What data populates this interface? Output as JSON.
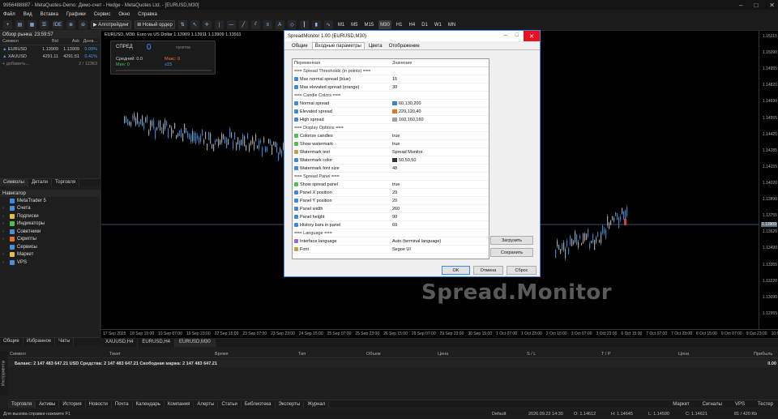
{
  "window": {
    "title": "9956488887 - MetaQuotes-Demo: Демо-счет - Hedge - MetaQuotes Ltd. - [EURUSD,M30]"
  },
  "menu": [
    "Файл",
    "Вид",
    "Вставка",
    "Графики",
    "Сервис",
    "Окно",
    "Справка"
  ],
  "toolbar": {
    "algotrading": "Алготрейдинг",
    "new_order": "Новый ордер",
    "ide": "IDE",
    "timeframes": [
      "M1",
      "M5",
      "M15",
      "M30",
      "H1",
      "H4",
      "D1",
      "W1",
      "MN"
    ],
    "active_timeframe": "M30"
  },
  "market_watch": {
    "title": "Обзор рынка: 23:59:57",
    "columns": [
      "Символ",
      "Bid",
      "Ask",
      "Днев..."
    ],
    "rows": [
      {
        "symbol": "EURUSD",
        "bid": "1.13909",
        "ask": "1.13909",
        "change": "0.09%"
      },
      {
        "symbol": "XAUUSD",
        "bid": "4291.11",
        "ask": "4291.51",
        "change": "0.41%"
      }
    ],
    "add_label": "+ добавить...",
    "count": "2 / 12363"
  },
  "mw_tabs": [
    "Символы",
    "Детали",
    "Торговля"
  ],
  "navigator": {
    "title": "Навигатор",
    "items": [
      {
        "label": "MetaTrader 5",
        "color": "#3a8be0"
      },
      {
        "label": "Счета",
        "color": "#4a90d9"
      },
      {
        "label": "Подписки",
        "color": "#e0c040"
      },
      {
        "label": "Индикаторы",
        "color": "#4cc24c"
      },
      {
        "label": "Советники",
        "color": "#4a90d9"
      },
      {
        "label": "Скрипты",
        "color": "#e8742b"
      },
      {
        "label": "Сервисы",
        "color": "#4a90d9"
      },
      {
        "label": "Маркет",
        "color": "#e0c040"
      },
      {
        "label": "VPS",
        "color": "#4a90d9"
      }
    ]
  },
  "nav_tabs": [
    "Общие",
    "Избранное",
    "Чаты"
  ],
  "chart": {
    "title": "EURUSD, M30:  Euro vs US Dollar   1.13909  1.13911  1.13909  1.13911",
    "price_ticks": [
      "1.15215",
      "1.15090",
      "1.14955",
      "1.14820",
      "1.14690",
      "1.14555",
      "1.14420",
      "1.14285",
      "1.14155",
      "1.14020",
      "1.13890",
      "1.13755",
      "1.13620",
      "1.13490",
      "1.13355",
      "1.13220",
      "1.13090",
      "1.12955"
    ],
    "current_price": "1.13909",
    "time_ticks": [
      "17 Sep 2025",
      "18 Sep 15:00",
      "19 Sep 07:00",
      "19 Sep 23:00",
      "22 Sep 15:00",
      "23 Sep 07:00",
      "23 Sep 23:00",
      "24 Sep 15:00",
      "25 Sep 07:00",
      "25 Sep 23:00",
      "26 Sep 15:00",
      "29 Sep 07:00",
      "29 Sep 23:00",
      "30 Sep 15:00",
      "1 Oct 07:00",
      "1 Oct 23:00",
      "2 Oct 15:00",
      "3 Oct 07:00",
      "3 Oct 23:00",
      "6 Oct 15:00",
      "7 Oct 07:00",
      "7 Oct 23:00",
      "8 Oct 15:00",
      "9 Oct 07:00",
      "9 Oct 23:00",
      "10 Oct 15:00"
    ],
    "watermark": "Spread.Monitor",
    "chart_tabs": [
      "XAUUSD,H4",
      "EURUSD,H4",
      "EURUSD,M30"
    ]
  },
  "spread_panel": {
    "label": "СПРЕД",
    "value": "0",
    "unit": "пунктов",
    "avg": "Средний: 0.0",
    "max": "Макс: 0",
    "min": "Мин: 0",
    "range": "≤15",
    "level": 0.0
  },
  "dialog": {
    "title": "SpreadMonitor 1.00 (EURUSD,M30)",
    "tabs": [
      "Общие",
      "Входные параметры",
      "Цвета",
      "Отображение"
    ],
    "active_tab": "Входные параметры",
    "columns": [
      "Переменная",
      "Значение"
    ],
    "rows": [
      {
        "type": "sep",
        "name": "=== Spread Thresholds (in points) ==="
      },
      {
        "type": "param",
        "icon": "#3a8be0",
        "name": "Max normal spread (blue)",
        "value": "15"
      },
      {
        "type": "param",
        "icon": "#3a8be0",
        "name": "Max elevated spread (orange)",
        "value": "30"
      },
      {
        "type": "sep",
        "name": "=== Candle Colors ==="
      },
      {
        "type": "param",
        "icon": "#3a8be0",
        "name": "Normal spread",
        "value": "60,130,200",
        "swatch": "#3c82c8"
      },
      {
        "type": "param",
        "icon": "#3a8be0",
        "name": "Elevated spread",
        "value": "220,120,40",
        "swatch": "#dc7828"
      },
      {
        "type": "param",
        "icon": "#3a8be0",
        "name": "High spread",
        "value": "160,160,160",
        "swatch": "#a0a0a0"
      },
      {
        "type": "sep",
        "name": "=== Display Options ==="
      },
      {
        "type": "param",
        "icon": "#4cc24c",
        "name": "Colorize candles",
        "value": "true"
      },
      {
        "type": "param",
        "icon": "#4cc24c",
        "name": "Show watermark",
        "value": "true"
      },
      {
        "type": "param",
        "icon": "#c0a040",
        "name": "Watermark text",
        "value": "Spread Monitor"
      },
      {
        "type": "param",
        "icon": "#3a8be0",
        "name": "Watermark color",
        "value": "50,50,50",
        "swatch": "#323232"
      },
      {
        "type": "param",
        "icon": "#3a8be0",
        "name": "Watermark font size",
        "value": "48"
      },
      {
        "type": "sep",
        "name": "=== Spread Panel ==="
      },
      {
        "type": "param",
        "icon": "#4cc24c",
        "name": "Show spread panel",
        "value": "true"
      },
      {
        "type": "param",
        "icon": "#3a8be0",
        "name": "Panel X position",
        "value": "20"
      },
      {
        "type": "param",
        "icon": "#3a8be0",
        "name": "Panel Y position",
        "value": "20"
      },
      {
        "type": "param",
        "icon": "#3a8be0",
        "name": "Panel width",
        "value": "260"
      },
      {
        "type": "param",
        "icon": "#3a8be0",
        "name": "Panel height",
        "value": "90"
      },
      {
        "type": "param",
        "icon": "#3a8be0",
        "name": "History bars in panel",
        "value": "60"
      },
      {
        "type": "sep",
        "name": "=== Language ==="
      },
      {
        "type": "param",
        "icon": "#9a6ad0",
        "name": "Interface language",
        "value": "Auto (terminal language)"
      },
      {
        "type": "param",
        "icon": "#c0a040",
        "name": "Font",
        "value": "Segoe UI"
      }
    ],
    "load_button": "Загрузить",
    "save_button": "Сохранить",
    "ok_button": "OK",
    "cancel_button": "Отмена",
    "reset_button": "Сброс"
  },
  "toolbox": {
    "columns": [
      "Символ",
      "Тикет",
      "Время",
      "Тип",
      "Объем",
      "Цена",
      "S / L",
      "T / P",
      "Цена",
      "Прибыль"
    ],
    "balance": "Баланс: 2 147 483 647.21 USD  Средства: 2 147 483 647.21  Свободная маржа: 2 147 483 647.21",
    "profit": "0.00",
    "side_label": "Инструменты",
    "tabs": [
      "Торговля",
      "Активы",
      "История",
      "Новости",
      "Почта",
      "Календарь",
      "Компания",
      "Алерты",
      "Статьи",
      "Библиотека",
      "Эксперты",
      "Журнал"
    ],
    "right_items": [
      "Маркет",
      "Сигналы",
      "VPS",
      "Тестер"
    ]
  },
  "status": {
    "help": "Для вызова справки нажмите F1",
    "profile": "Default",
    "time": "2026.09.22 14:30",
    "o": "O: 1.14612",
    "h": "H: 1.14645",
    "l": "L: 1.14590",
    "c": "C: 1.14621",
    "net": "81 / 420 Kb"
  }
}
